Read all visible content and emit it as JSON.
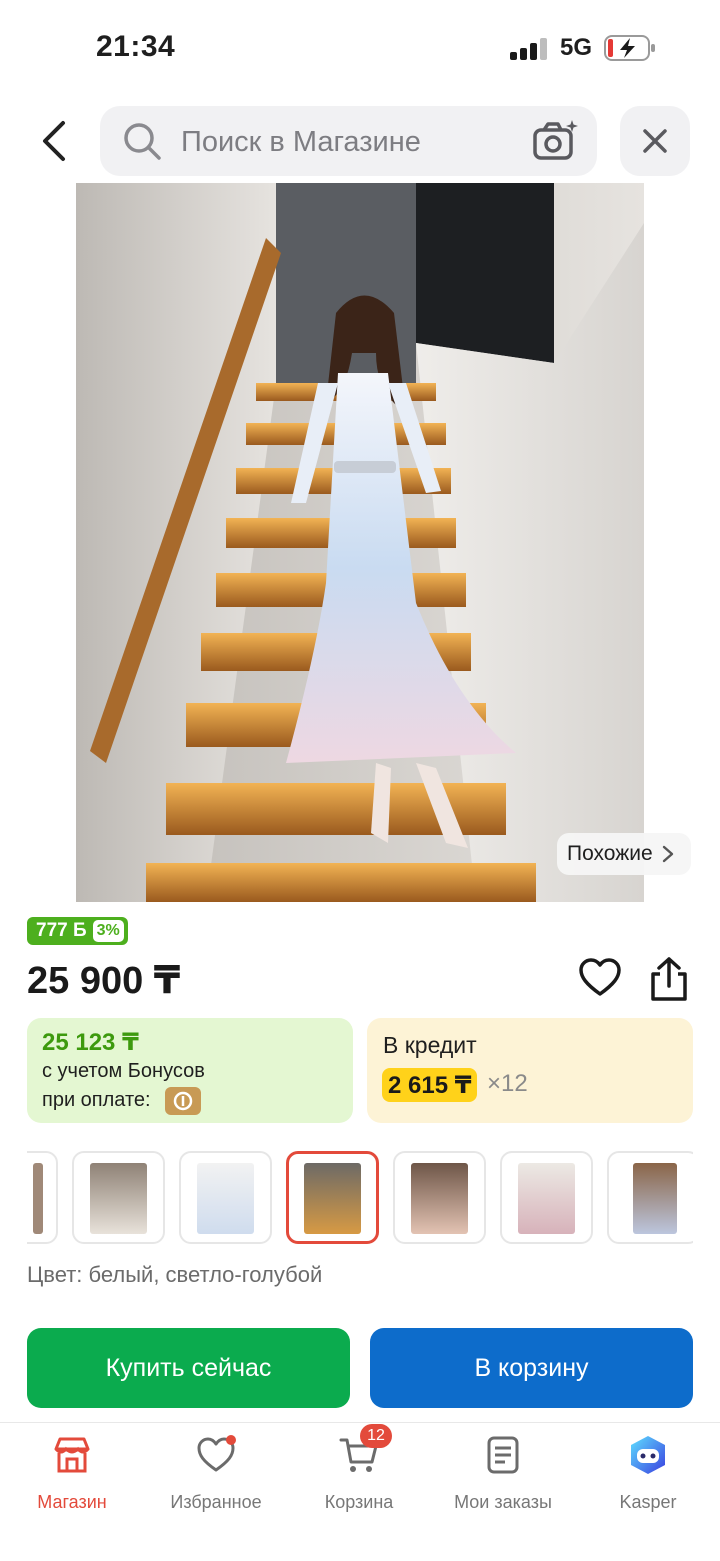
{
  "status": {
    "time": "21:34",
    "network": "5G"
  },
  "search": {
    "placeholder": "Поиск в Магазине"
  },
  "product": {
    "similar_label": "Похожие",
    "bonus_points": "777 Б",
    "bonus_percent": "3%",
    "price": "25 900 ₸",
    "bonus_price": "25 123 ₸",
    "bonus_line1": "с учетом Бонусов",
    "bonus_line2": "при оплате:",
    "credit_title": "В кредит",
    "credit_amount": "2 615 ₸",
    "credit_times": "×12",
    "color_label": "Цвет: белый, светло-голубой"
  },
  "actions": {
    "buy_now": "Купить сейчас",
    "add_to_cart": "В корзину"
  },
  "tabs": [
    {
      "label": "Магазин",
      "icon": "store-icon",
      "active": true
    },
    {
      "label": "Избранное",
      "icon": "heart-icon"
    },
    {
      "label": "Корзина",
      "icon": "cart-icon",
      "badge": "12"
    },
    {
      "label": "Мои заказы",
      "icon": "orders-icon"
    },
    {
      "label": "Kasper",
      "icon": "kasper-icon"
    }
  ],
  "colors": {
    "accent": "#e34a3b",
    "buy": "#0bab4e",
    "cart": "#0d6ccb",
    "bonus_green": "#4daf1e"
  }
}
